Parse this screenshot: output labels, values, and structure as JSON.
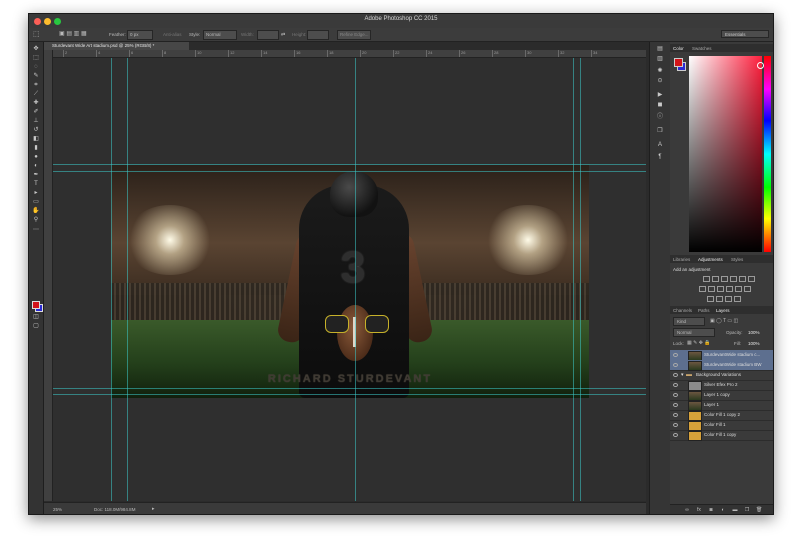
{
  "app": {
    "title": "Adobe Photoshop CC 2015"
  },
  "options_bar": {
    "feather_label": "Feather:",
    "feather_value": "0 px",
    "anti_alias": "Anti-alias",
    "style_label": "Style:",
    "style_value": "Normal",
    "width_label": "Width:",
    "height_label": "Height:",
    "refine_edge": "Refine Edge...",
    "workspace": "Essentials"
  },
  "document": {
    "tab_title": "Sturdevant Wide Art stadium.psd @ 25% (RGB/8) *",
    "caption": "RICHARD STURDEVANT",
    "jersey_number": "3"
  },
  "ruler": {
    "labels": [
      "2",
      "4",
      "6",
      "8",
      "10",
      "12",
      "14",
      "16",
      "18",
      "20",
      "22",
      "24",
      "26",
      "28",
      "30",
      "32",
      "34"
    ]
  },
  "status": {
    "zoom": "25%",
    "doc": "Doc: 118.0M/984.8M"
  },
  "color_panel": {
    "tabs": [
      "Color",
      "Swatches"
    ],
    "fg_color": "#d1141a",
    "bg_color": "#2a2ad4"
  },
  "adjustments_panel": {
    "tabs": [
      "Libraries",
      "Adjustments",
      "Styles"
    ],
    "header": "Add an adjustment"
  },
  "layers_panel": {
    "tabs": [
      "Channels",
      "Paths",
      "Layers"
    ],
    "kind_label": "Kind",
    "blend_mode": "Normal",
    "opacity_label": "Opacity:",
    "opacity_value": "100%",
    "lock_label": "Lock:",
    "fill_label": "Fill:",
    "fill_value": "100%",
    "layers": [
      {
        "name": "SturdevantWide stadium c...",
        "selected": true
      },
      {
        "name": "SturdevantWide stadium BW",
        "selected": true
      },
      {
        "name": "Background Variations",
        "selected": false
      },
      {
        "name": "Silver Efex Pro 2",
        "selected": false
      },
      {
        "name": "Layer 1 copy",
        "selected": false
      },
      {
        "name": "Layer 1",
        "selected": false
      },
      {
        "name": "Color Fill 1 copy 2",
        "selected": false
      },
      {
        "name": "Color Fill 1",
        "selected": false
      },
      {
        "name": "Color Fill 1 copy",
        "selected": false
      }
    ]
  }
}
